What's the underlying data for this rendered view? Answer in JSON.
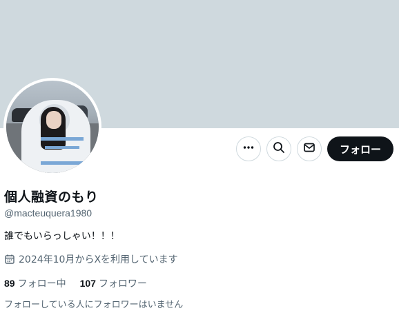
{
  "profile": {
    "display_name": "個人融資のもり",
    "handle": "@macteuquera1980",
    "bio": "誰でもいらっしゃい！！！",
    "joined": "2024年10月からXを利用しています",
    "following_count": "89",
    "following_label": "フォロー中",
    "followers_count": "107",
    "followers_label": "フォロワー",
    "followers_you_know": "フォローしている人にフォロワーはいません"
  },
  "actions": {
    "follow_label": "フォロー",
    "icons": [
      "more-icon",
      "search-icon",
      "message-icon"
    ]
  },
  "colors": {
    "banner": "#cfd9de",
    "primary_text": "#0f1419",
    "secondary_text": "#536471",
    "follow_bg": "#0f1419"
  }
}
